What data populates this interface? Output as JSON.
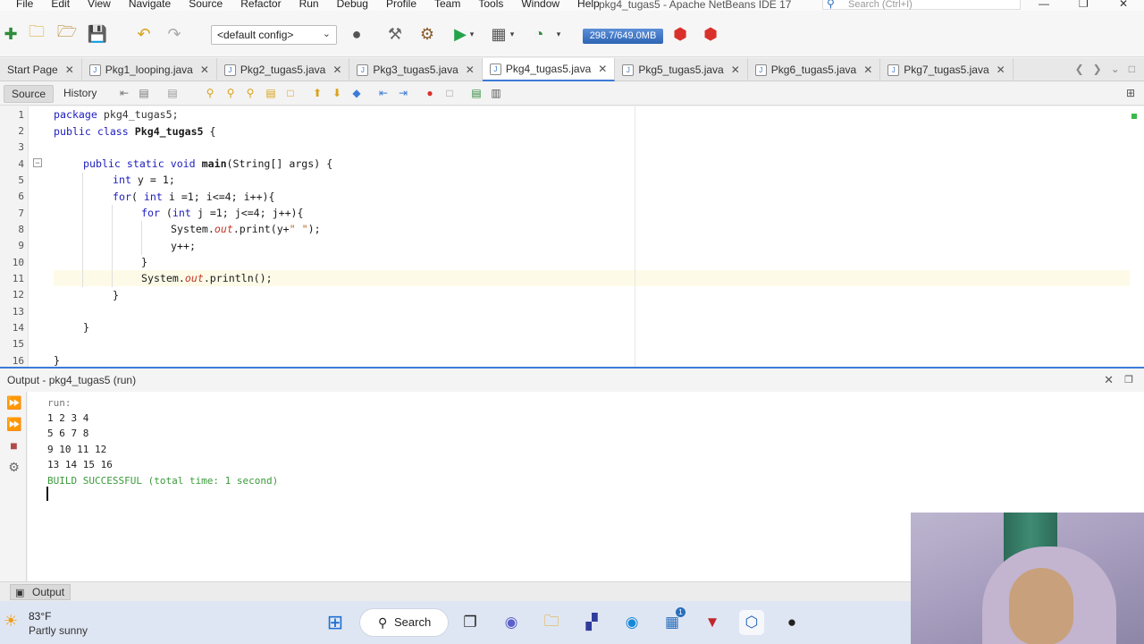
{
  "menubar": {
    "items": [
      "File",
      "Edit",
      "View",
      "Navigate",
      "Source",
      "Refactor",
      "Run",
      "Debug",
      "Profile",
      "Team",
      "Tools",
      "Window",
      "Help"
    ],
    "window_title": "pkg4_tugas5 - Apache NetBeans IDE 17",
    "search_placeholder": "Search (Ctrl+I)"
  },
  "toolbar": {
    "config_value": "<default config>",
    "memory": "298.7/649.0MB"
  },
  "tabs": [
    {
      "label": "Start Page",
      "active": false
    },
    {
      "label": "Pkg1_looping.java",
      "active": false
    },
    {
      "label": "Pkg2_tugas5.java",
      "active": false
    },
    {
      "label": "Pkg3_tugas5.java",
      "active": false
    },
    {
      "label": "Pkg4_tugas5.java",
      "active": true
    },
    {
      "label": "Pkg5_tugas5.java",
      "active": false
    },
    {
      "label": "Pkg6_tugas5.java",
      "active": false
    },
    {
      "label": "Pkg7_tugas5.java",
      "active": false
    }
  ],
  "editor_toolbar": {
    "source_label": "Source",
    "history_label": "History"
  },
  "code": {
    "line_numbers": [
      "1",
      "2",
      "3",
      "4",
      "5",
      "6",
      "7",
      "8",
      "9",
      "10",
      "11",
      "12",
      "13",
      "14",
      "15",
      "16"
    ],
    "l1": {
      "kw": "package",
      "rest": " pkg4_tugas5;"
    },
    "l2": {
      "kw": "public class",
      "name": "Pkg4_tugas5",
      "rest": " {"
    },
    "l4": {
      "kw": "public static void",
      "name": "main",
      "rest": "(String[] args) {"
    },
    "l5": {
      "kw": "int",
      "rest": " y = 1;"
    },
    "l6": {
      "kw": "for",
      "p1": "( ",
      "kw2": "int",
      "rest": " i =1; i<=4; i++){"
    },
    "l7": {
      "kw": "for",
      "p1": " (",
      "kw2": "int",
      "rest": " j =1; j<=4; j++){"
    },
    "l8": {
      "a": "System.",
      "fld": "out",
      "b": ".print(y+",
      "str": "\" \"",
      "c": ");"
    },
    "l9": {
      "a": "y++;"
    },
    "l10": {
      "a": "}"
    },
    "l11": {
      "a": "System.",
      "fld": "out",
      "b": ".println();"
    },
    "l12": {
      "a": "}"
    },
    "l14": {
      "a": "}"
    },
    "l16": {
      "a": "}"
    }
  },
  "output": {
    "title": "Output - pkg4_tugas5 (run)",
    "lines": [
      "run:",
      "1 2 3 4",
      "5 6 7 8",
      "9 10 11 12",
      "13 14 15 16"
    ],
    "build": "BUILD SUCCESSFUL (total time: 1 second)",
    "bottom_tab": "Output"
  },
  "taskbar": {
    "temperature": "83°F",
    "weather": "Partly sunny",
    "search_label": "Search",
    "store_badge": "1"
  },
  "colors": {
    "accent": "#3d7bd8",
    "keyword": "#2020c0",
    "field": "#c0392b",
    "success": "#3a9a3a"
  }
}
